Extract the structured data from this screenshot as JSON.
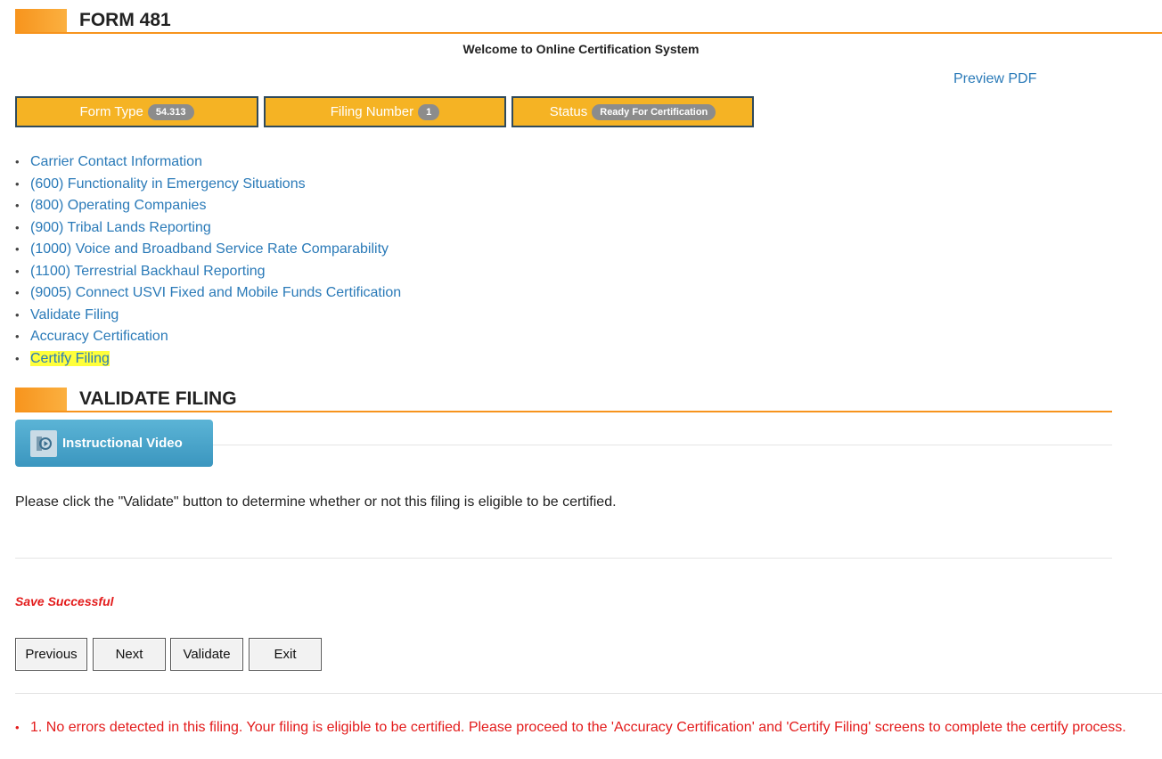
{
  "form_header": {
    "title": "FORM 481"
  },
  "welcome": "Welcome to Online Certification System",
  "preview_pdf": "Preview PDF",
  "info_boxes": [
    {
      "label": "Form Type",
      "value": "54.313"
    },
    {
      "label": "Filing Number",
      "value": "1"
    },
    {
      "label": "Status",
      "value": "Ready For Certification"
    }
  ],
  "nav_items": [
    {
      "label": "Carrier Contact Information"
    },
    {
      "label": "(600) Functionality in Emergency Situations"
    },
    {
      "label": "(800) Operating Companies"
    },
    {
      "label": "(900) Tribal Lands Reporting"
    },
    {
      "label": "(1000) Voice and Broadband Service Rate Comparability"
    },
    {
      "label": "(1100) Terrestrial Backhaul Reporting"
    },
    {
      "label": "(9005) Connect USVI Fixed and Mobile Funds Certification"
    },
    {
      "label": "Validate Filing"
    },
    {
      "label": "Accuracy Certification"
    },
    {
      "label": "Certify Filing"
    }
  ],
  "validate_header": {
    "title": "VALIDATE FILING"
  },
  "video_button": {
    "label": "Instructional Video",
    "icon": "video-icon"
  },
  "instruction": "Please click the \"Validate\" button to determine whether or not this filing is eligible to be certified.",
  "save_message": "Save Successful",
  "buttons": {
    "previous": "Previous",
    "next": "Next",
    "validate": "Validate",
    "exit": "Exit"
  },
  "results": [
    "1. No errors detected in this filing. Your filing is eligible to be certified. Please proceed to the 'Accuracy Certification' and 'Certify Filing' screens to complete the certify process."
  ],
  "colors": {
    "accent_orange": "#f7941d",
    "info_box_bg": "#f5b324",
    "link_blue": "#2a7ab8",
    "error_red": "#e31b1b",
    "highlight_yellow": "#ffff3b"
  }
}
